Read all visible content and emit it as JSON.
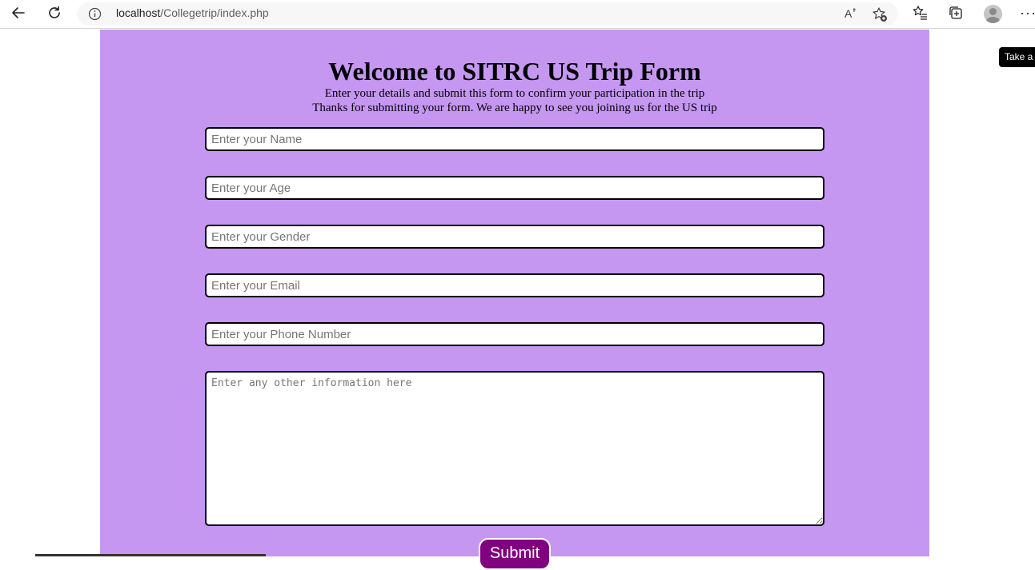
{
  "browser": {
    "url_host": "localhost",
    "url_path": "/Collegetrip/index.php",
    "read_aloud_label": "A̅",
    "more_label": "···"
  },
  "tooltip": {
    "text": "Take a"
  },
  "form": {
    "title": "Welcome to SITRC US Trip Form",
    "subtitle": "Enter your details and submit this form to confirm your participation in the trip",
    "thanks": "Thanks for submitting your form. We are happy to see you joining us for the US trip",
    "name_placeholder": "Enter your Name",
    "age_placeholder": "Enter your Age",
    "gender_placeholder": "Enter your Gender",
    "email_placeholder": "Enter your Email",
    "phone_placeholder": "Enter your Phone Number",
    "info_placeholder": "Enter any other information here",
    "submit_label": "Submit"
  },
  "colors": {
    "panel_bg": "#c597f1",
    "submit_bg": "#800080"
  }
}
